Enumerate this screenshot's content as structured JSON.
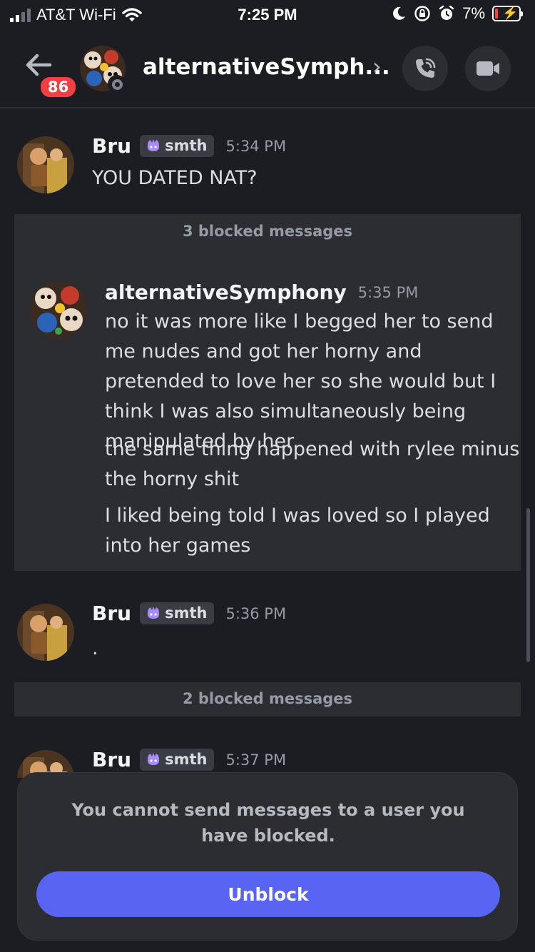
{
  "status_bar": {
    "carrier": "AT&T Wi-Fi",
    "time": "7:25 PM",
    "battery_percent": "7%"
  },
  "header": {
    "unread_count": "86",
    "title": "alternativeSymph...",
    "chevron": "›"
  },
  "messages": [
    {
      "author": "Bru",
      "tag": "smth",
      "time": "5:34 PM",
      "lines": [
        "YOU DATED NAT?"
      ]
    },
    {
      "author": "alternativeSymphony",
      "time": "5:35 PM",
      "paragraphs": [
        "no it was more like I begged her to send me nudes and got her horny and pretended to love her so she would but I think I was also simultaneously being manipulated by her",
        "the same thing happened with rylee minus the horny shit",
        "I liked being told I was loved so I played into her games"
      ]
    },
    {
      "author": "Bru",
      "tag": "smth",
      "time": "5:36 PM",
      "lines": [
        "."
      ]
    },
    {
      "author": "Bru",
      "tag": "smth",
      "time": "5:37 PM"
    }
  ],
  "blocked_groups": [
    {
      "label": "3 blocked messages"
    },
    {
      "label": "2 blocked messages"
    }
  ],
  "blocked_panel": {
    "notice": "You cannot send messages to a user you have blocked.",
    "button_label": "Unblock"
  },
  "colors": {
    "background": "#1c1d22",
    "blocked_bg": "#2b2d31",
    "accent": "#5865f2",
    "badge": "#f23f43"
  },
  "icons": [
    "signal-icon",
    "wifi-icon",
    "moon-icon",
    "rotation-lock-icon",
    "alarm-icon",
    "battery-icon",
    "back-arrow-icon",
    "chevron-right-icon",
    "phone-call-icon",
    "video-camera-icon",
    "tag-icon"
  ]
}
